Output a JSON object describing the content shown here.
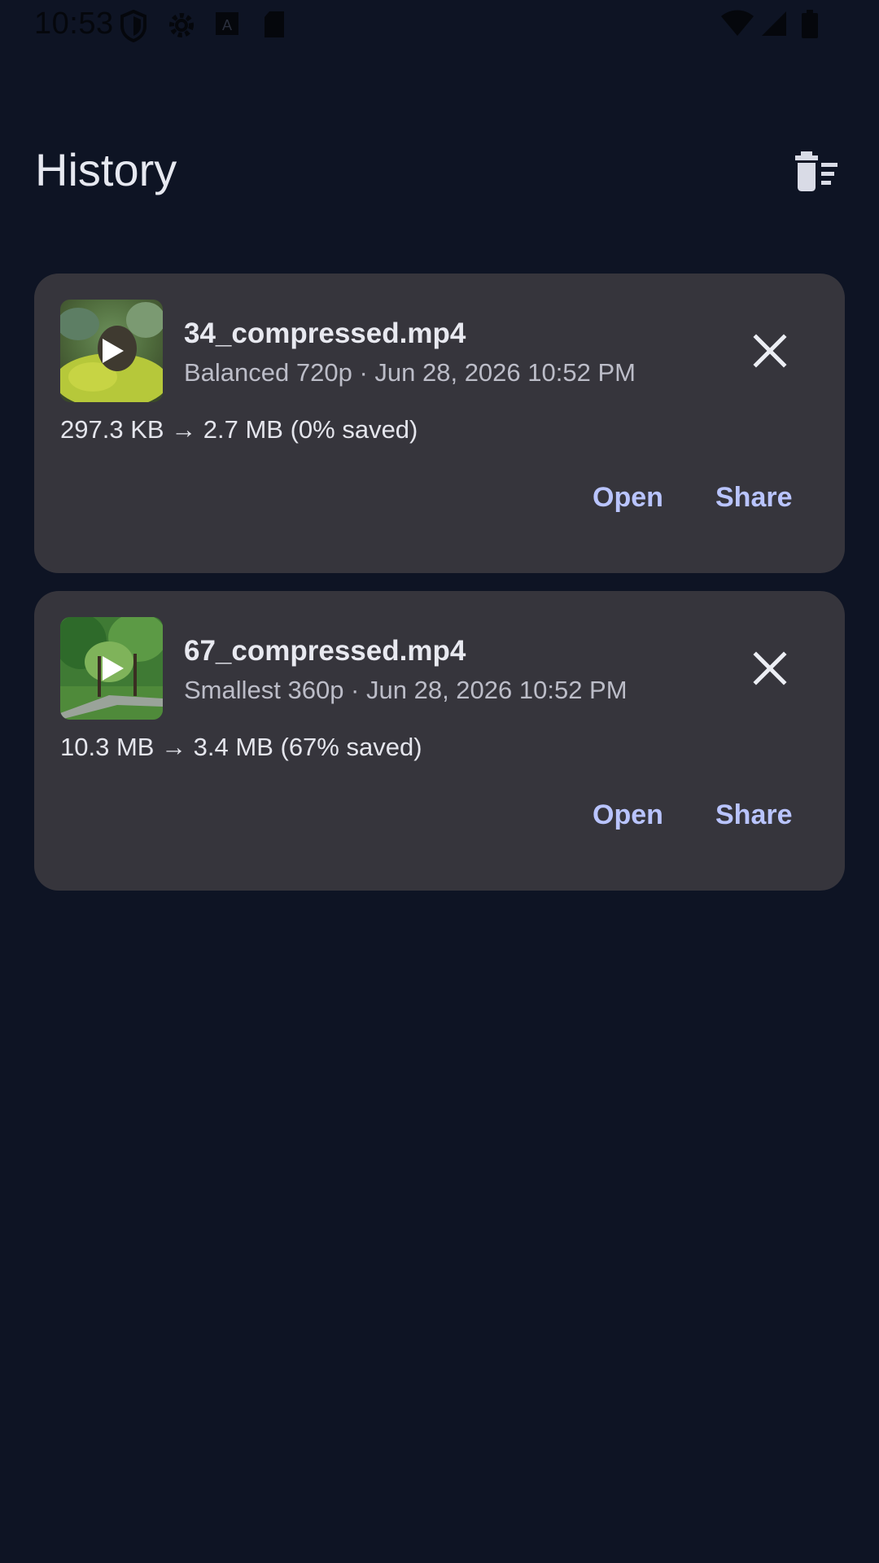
{
  "status_bar": {
    "time": "10:53",
    "left_icons": [
      "shield-icon",
      "gear-icon",
      "app-a-icon",
      "sd-card-icon"
    ],
    "right_icons": [
      "wifi-icon",
      "signal-icon",
      "battery-icon"
    ]
  },
  "header": {
    "title": "History",
    "clear_icon": "delete-sweep-icon"
  },
  "history": [
    {
      "file_name": "34_compressed.mp4",
      "meta": "Balanced 720p · Jun 28, 2026 10:52 PM",
      "sizes": "297.3 KB → 2.7 MB (0% saved)",
      "open_label": "Open",
      "share_label": "Share"
    },
    {
      "file_name": "67_compressed.mp4",
      "meta": "Smallest 360p · Jun 28, 2026 10:52 PM",
      "sizes": "10.3 MB → 3.4 MB (67% saved)",
      "open_label": "Open",
      "share_label": "Share"
    }
  ],
  "colors": {
    "background": "#0e1424",
    "card": "#36353c",
    "accent": "#b9c4ff"
  }
}
